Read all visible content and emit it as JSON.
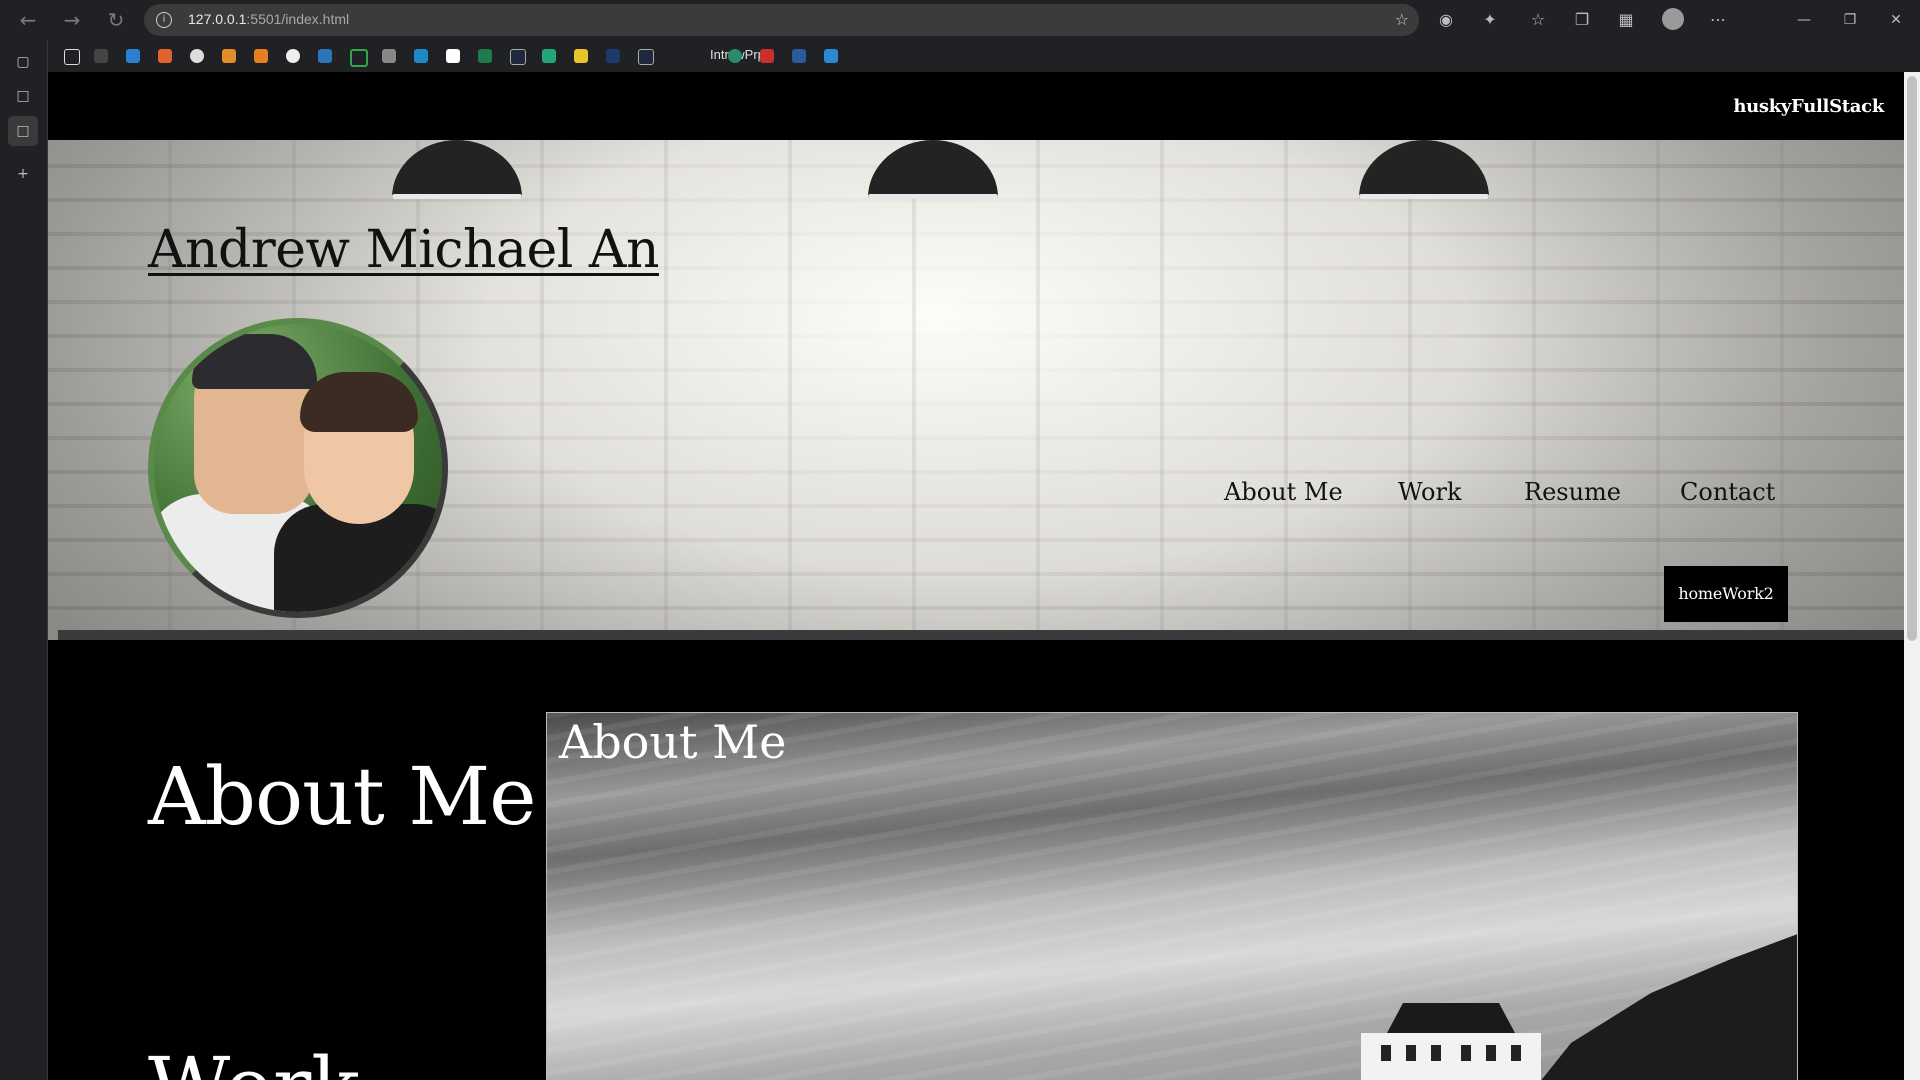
{
  "browser": {
    "url_host": "127.0.0.1",
    "url_path": ":5501/index.html",
    "bookmark_label": "IntrvwPrp"
  },
  "site": {
    "brand": "huskyFullStack",
    "name": "Andrew Michael An",
    "nav": [
      "About Me",
      "Work",
      "Resume",
      "Contact"
    ],
    "cta": "homeWork2"
  },
  "main": {
    "side_title": "About Me",
    "side_next": "Work",
    "card_title": "About Me"
  },
  "colors": {
    "page_bg": "#000000",
    "text_dark": "#111111",
    "text_light": "#ffffff",
    "chrome_bg": "#202124"
  },
  "icons": {
    "back": "arrow-left-icon",
    "forward": "arrow-right-icon",
    "reload": "reload-icon",
    "info": "info-icon",
    "favorite": "star-add-icon"
  }
}
